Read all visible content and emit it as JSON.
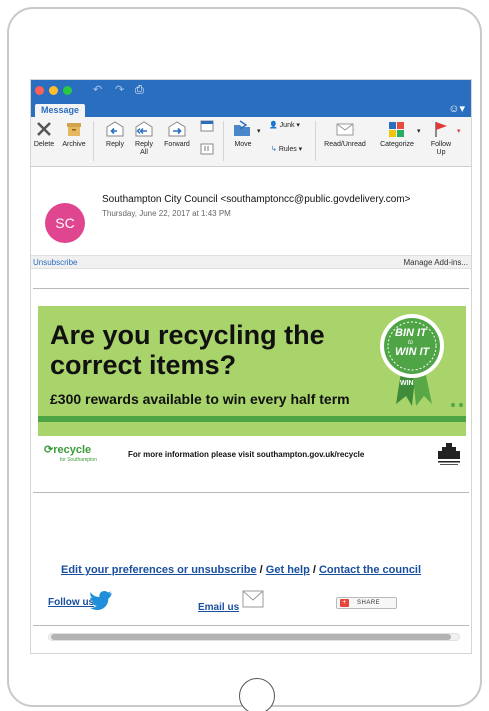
{
  "ribbon": {
    "tab": "Message",
    "buttons": {
      "delete": "Delete",
      "archive": "Archive",
      "reply": "Reply",
      "reply_all": "Reply All",
      "forward": "Forward",
      "move": "Move",
      "junk": "Junk ▾",
      "rules": "Rules ▾",
      "read_unread": "Read/Unread",
      "categorize": "Categorize",
      "follow_up": "Follow Up"
    }
  },
  "message": {
    "avatar_initials": "SC",
    "sender": "Southampton City Council <southamptoncc@public.govdelivery.com>",
    "date": "Thursday, June 22, 2017 at 1:43 PM"
  },
  "infobar": {
    "unsubscribe": "Unsubscribe",
    "manage_addins": "Manage Add-ins..."
  },
  "banner": {
    "headline_line1": "Are you recycling the",
    "headline_line2": "correct items?",
    "rewards": "£300 rewards available to win every half term",
    "badge_bin": "BIN IT",
    "badge_to": "to",
    "badge_win": "WIN IT",
    "recycle_logo": "recycle",
    "recycle_sub": "for Southampton",
    "more_info": "For more information please visit southampton.gov.uk/recycle"
  },
  "footer": {
    "edit_prefs": "Edit your preferences or unsubscribe",
    "get_help": "Get help",
    "contact": "Contact the council",
    "separator": " / ",
    "follow_us": "Follow us",
    "email_us": "Email us",
    "share": "SHARE"
  },
  "colors": {
    "titlebar": "#2a6ebf",
    "avatar": "#e0468f",
    "banner_green": "#a9d46b",
    "link_blue": "#1a4fa0"
  }
}
